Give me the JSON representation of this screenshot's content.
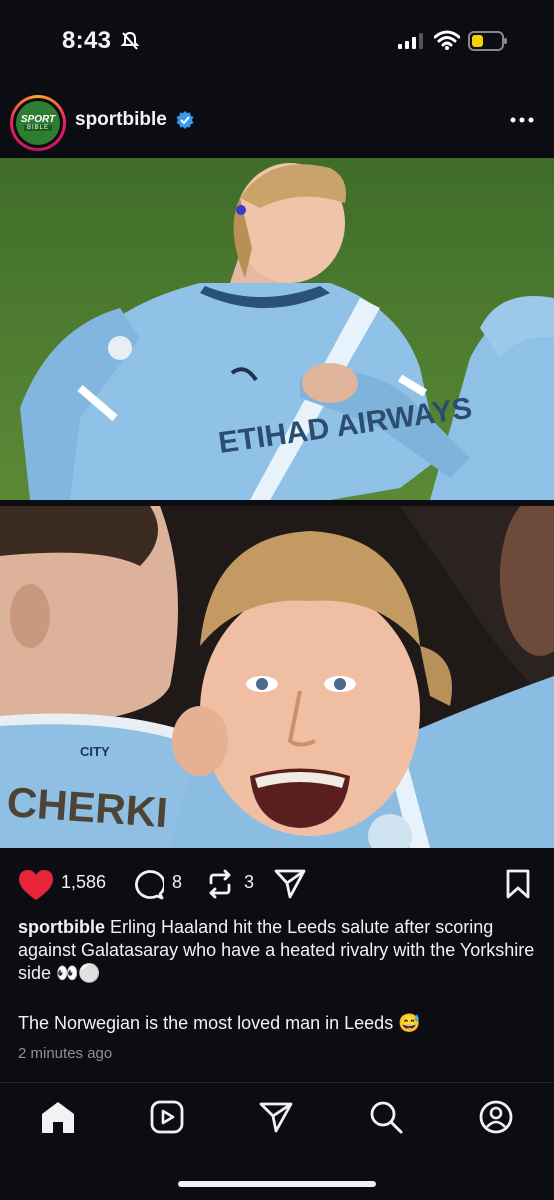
{
  "status_bar": {
    "time": "8:43"
  },
  "post": {
    "username": "sportbible",
    "avatar_logo_top": "SPORT",
    "avatar_logo_bottom": "BIBLE",
    "image_top_text": "ETIHAD AIRWAYS",
    "image_bottom_text": "CHERKI",
    "image_bottom_club": "CITY",
    "likes": "1,586",
    "comments": "8",
    "reposts": "3",
    "caption_user": "sportbible",
    "caption_text": "Erling Haaland hit the Leeds salute after scoring against Galatasaray who have a heated rivalry with the Yorkshire side 👀⚪",
    "caption_text_2": "The Norwegian is the most loved man in Leeds 😅",
    "timestamp": "2 minutes ago"
  },
  "colors": {
    "like": "#e8243b",
    "verified": "#3897f0",
    "battery": "#f5d100",
    "background": "#0b0d12"
  },
  "nav": {
    "items": [
      "home-icon",
      "reels-icon",
      "send-icon",
      "search-icon",
      "profile-icon"
    ]
  }
}
